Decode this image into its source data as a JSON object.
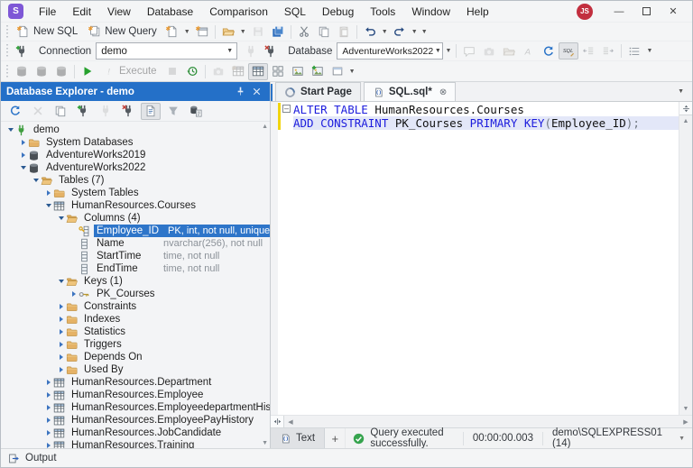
{
  "window": {
    "app_logo": "S",
    "menu": [
      "File",
      "Edit",
      "View",
      "Database",
      "Comparison",
      "SQL",
      "Debug",
      "Tools",
      "Window",
      "Help"
    ],
    "avatar": "JS",
    "controls": {
      "minimize": "minimize-icon",
      "maximize": "maximize-icon",
      "close": "close-icon"
    }
  },
  "toolbars": {
    "row2": [
      {
        "t": "grip"
      },
      {
        "t": "btn",
        "icon": "newsql",
        "label": "New SQL",
        "name": "new-sql-button"
      },
      {
        "t": "btn",
        "icon": "newquery",
        "label": "New Query",
        "name": "new-query-button"
      },
      {
        "t": "icon",
        "icon": "newdoc",
        "name": "new-document-button"
      },
      {
        "t": "caret"
      },
      {
        "t": "icon",
        "icon": "newwin",
        "name": "new-window-button"
      },
      {
        "t": "sep"
      },
      {
        "t": "icon",
        "icon": "openfolder",
        "name": "open-file-button"
      },
      {
        "t": "caret"
      },
      {
        "t": "icon",
        "icon": "save",
        "state": "dis",
        "name": "save-button"
      },
      {
        "t": "icon",
        "icon": "saveall",
        "name": "save-all-button"
      },
      {
        "t": "sep"
      },
      {
        "t": "icon",
        "icon": "cut",
        "name": "cut-button"
      },
      {
        "t": "icon",
        "icon": "copy",
        "name": "copy-button"
      },
      {
        "t": "icon",
        "icon": "paste",
        "state": "dis",
        "name": "paste-button"
      },
      {
        "t": "sep"
      },
      {
        "t": "icon",
        "icon": "undo",
        "name": "undo-button"
      },
      {
        "t": "caret"
      },
      {
        "t": "icon",
        "icon": "redo",
        "name": "redo-button"
      },
      {
        "t": "caret"
      },
      {
        "t": "caret"
      }
    ],
    "row3a": [
      {
        "t": "grip"
      },
      {
        "t": "icon",
        "icon": "plugnew",
        "name": "new-connection-button"
      }
    ],
    "row3b": [
      {
        "t": "icon",
        "icon": "plug",
        "state": "dis",
        "name": "connect-button"
      },
      {
        "t": "icon",
        "icon": "plugx",
        "name": "disconnect-button"
      }
    ],
    "row3c": [
      {
        "t": "caret"
      },
      {
        "t": "sep"
      },
      {
        "t": "icon",
        "icon": "comment",
        "state": "dis",
        "name": "comment-button"
      },
      {
        "t": "icon",
        "icon": "camera",
        "state": "dis",
        "name": "snapshot-button"
      },
      {
        "t": "icon",
        "icon": "openfolder",
        "state": "dis",
        "name": "browse-button"
      },
      {
        "t": "icon",
        "icon": "fonta",
        "state": "dis",
        "name": "case-button"
      },
      {
        "t": "icon",
        "icon": "refresh",
        "name": "refresh-button"
      },
      {
        "t": "icon",
        "icon": "sqlfmt",
        "state": "act",
        "name": "format-sql-button"
      },
      {
        "t": "icon",
        "icon": "outdent",
        "state": "dis",
        "name": "outdent-button"
      },
      {
        "t": "icon",
        "icon": "indent",
        "state": "dis",
        "name": "indent-button"
      },
      {
        "t": "sep"
      },
      {
        "t": "icon",
        "icon": "list",
        "name": "list-members-button"
      },
      {
        "t": "caret"
      }
    ],
    "row4": [
      {
        "t": "grip"
      },
      {
        "t": "icon",
        "icon": "db",
        "state": "dis",
        "name": "edit-database-button"
      },
      {
        "t": "icon",
        "icon": "db",
        "state": "dis",
        "name": "refresh-database-button"
      },
      {
        "t": "icon",
        "icon": "db",
        "state": "dis",
        "name": "drop-database-button"
      },
      {
        "t": "sep"
      },
      {
        "t": "icon",
        "icon": "play",
        "name": "execute-play-button"
      },
      {
        "t": "btn",
        "icon": "excl",
        "label": "Execute",
        "state": "dis",
        "name": "execute-button"
      },
      {
        "t": "icon",
        "icon": "stop",
        "state": "dis",
        "name": "stop-button"
      },
      {
        "t": "icon",
        "icon": "history",
        "name": "query-history-button"
      },
      {
        "t": "sep"
      },
      {
        "t": "icon",
        "icon": "camera",
        "state": "dis",
        "name": "profiler-button"
      },
      {
        "t": "icon",
        "icon": "tablenew",
        "state": "dis",
        "name": "new-table-button"
      },
      {
        "t": "icon",
        "icon": "table",
        "state": "act",
        "name": "design-table-button"
      },
      {
        "t": "icon",
        "icon": "layout",
        "name": "layout-button"
      },
      {
        "t": "icon",
        "icon": "image",
        "name": "diagram-button"
      },
      {
        "t": "icon",
        "icon": "imageplus",
        "name": "add-diagram-button"
      },
      {
        "t": "icon",
        "icon": "winplus",
        "name": "new-view-button"
      },
      {
        "t": "caret"
      }
    ],
    "explorer": [
      {
        "t": "icon",
        "icon": "refresh",
        "name": "explorer-refresh-button"
      },
      {
        "t": "icon",
        "icon": "xgray",
        "state": "dis",
        "name": "explorer-delete-button"
      },
      {
        "t": "icon",
        "icon": "copy",
        "name": "explorer-duplicate-button"
      },
      {
        "t": "icon",
        "icon": "plugnew",
        "name": "explorer-new-connection-button"
      },
      {
        "t": "icon",
        "icon": "plug",
        "state": "dis",
        "name": "explorer-connect-button"
      },
      {
        "t": "icon",
        "icon": "plugx",
        "name": "explorer-disconnect-button"
      },
      {
        "t": "icon",
        "icon": "docview",
        "state": "act",
        "name": "explorer-details-button"
      },
      {
        "t": "icon",
        "icon": "funnel",
        "name": "explorer-filter-button"
      },
      {
        "t": "icon",
        "icon": "dbdoc",
        "name": "explorer-script-button"
      }
    ]
  },
  "connection_bar": {
    "connection_label": "Connection",
    "connection_value": "demo",
    "database_label": "Database",
    "database_value": "AdventureWorks2022"
  },
  "explorer": {
    "title": "Database Explorer - demo",
    "tree": [
      {
        "lv": 0,
        "ar": "e",
        "ic": "plugtree",
        "label": "demo"
      },
      {
        "lv": 1,
        "ar": "c",
        "ic": "folderc",
        "label": "System Databases"
      },
      {
        "lv": 1,
        "ar": "c",
        "ic": "db",
        "label": "AdventureWorks2019"
      },
      {
        "lv": 1,
        "ar": "e",
        "ic": "db",
        "label": "AdventureWorks2022"
      },
      {
        "lv": 2,
        "ar": "e",
        "ic": "foldero",
        "label": "Tables (7)"
      },
      {
        "lv": 3,
        "ar": "c",
        "ic": "folderc",
        "label": "System Tables"
      },
      {
        "lv": 3,
        "ar": "e",
        "ic": "table",
        "label": "HumanResources.Courses"
      },
      {
        "lv": 4,
        "ar": "e",
        "ic": "foldero",
        "label": "Columns (4)"
      },
      {
        "lv": 5,
        "ar": "",
        "ic": "keycol",
        "label": "Employee_ID",
        "detail": "PK, int, not null, unique",
        "sel": true
      },
      {
        "lv": 5,
        "ar": "",
        "ic": "col",
        "label": "Name",
        "detail": "nvarchar(256), not null"
      },
      {
        "lv": 5,
        "ar": "",
        "ic": "col",
        "label": "StartTime",
        "detail": "time, not null"
      },
      {
        "lv": 5,
        "ar": "",
        "ic": "col",
        "label": "EndTime",
        "detail": "time, not null"
      },
      {
        "lv": 4,
        "ar": "e",
        "ic": "foldero",
        "label": "Keys (1)"
      },
      {
        "lv": 5,
        "ar": "c",
        "ic": "key",
        "label": "PK_Courses"
      },
      {
        "lv": 4,
        "ar": "c",
        "ic": "folderc",
        "label": "Constraints"
      },
      {
        "lv": 4,
        "ar": "c",
        "ic": "folderc",
        "label": "Indexes"
      },
      {
        "lv": 4,
        "ar": "c",
        "ic": "folderc",
        "label": "Statistics"
      },
      {
        "lv": 4,
        "ar": "c",
        "ic": "folderc",
        "label": "Triggers"
      },
      {
        "lv": 4,
        "ar": "c",
        "ic": "folderc",
        "label": "Depends On"
      },
      {
        "lv": 4,
        "ar": "c",
        "ic": "folderc",
        "label": "Used By"
      },
      {
        "lv": 3,
        "ar": "c",
        "ic": "table",
        "label": "HumanResources.Department"
      },
      {
        "lv": 3,
        "ar": "c",
        "ic": "table",
        "label": "HumanResources.Employee"
      },
      {
        "lv": 3,
        "ar": "c",
        "ic": "table",
        "label": "HumanResources.EmployeedepartmentHistory"
      },
      {
        "lv": 3,
        "ar": "c",
        "ic": "table",
        "label": "HumanResources.EmployeePayHistory"
      },
      {
        "lv": 3,
        "ar": "c",
        "ic": "table",
        "label": "HumanResources.JobCandidate"
      },
      {
        "lv": 3,
        "ar": "c",
        "ic": "table",
        "label": "HumanResources.Training"
      }
    ]
  },
  "editor": {
    "tabs": [
      {
        "label": "Start Page",
        "icon": "compass",
        "active": false,
        "closable": false
      },
      {
        "label": "SQL.sql*",
        "icon": "sqldoc",
        "active": true,
        "closable": true
      }
    ],
    "code": [
      {
        "hl": false,
        "fold": true,
        "segments": [
          {
            "t": "ALTER TABLE",
            "c": "kw"
          },
          {
            "t": " HumanResources.Courses",
            "c": "id"
          }
        ]
      },
      {
        "hl": true,
        "fold": false,
        "segments": [
          {
            "t": "ADD CONSTRAINT",
            "c": "kw"
          },
          {
            "t": " PK_Courses ",
            "c": "id"
          },
          {
            "t": "PRIMARY KEY",
            "c": "kw"
          },
          {
            "t": "(",
            "c": "p"
          },
          {
            "t": "Employee_ID",
            "c": "id"
          },
          {
            "t": ");",
            "c": "p"
          }
        ]
      }
    ]
  },
  "statusbar": {
    "text_tab": "Text",
    "plus": "+",
    "status": "Query executed successfully.",
    "time": "00:00:00.003",
    "server": "demo\\SQLEXPRESS01 (14)"
  },
  "output": {
    "label": "Output"
  },
  "colors": {
    "accent_blue": "#2470c8",
    "selection_blue": "#2e75c9",
    "keyword_blue": "#1d1ddd",
    "line_highlight": "#e3e7f8",
    "change_bar_yellow": "#f1d40e",
    "success_green": "#36a44e",
    "avatar_red": "#c22f3f",
    "logo_purple": "#7e57d6"
  }
}
